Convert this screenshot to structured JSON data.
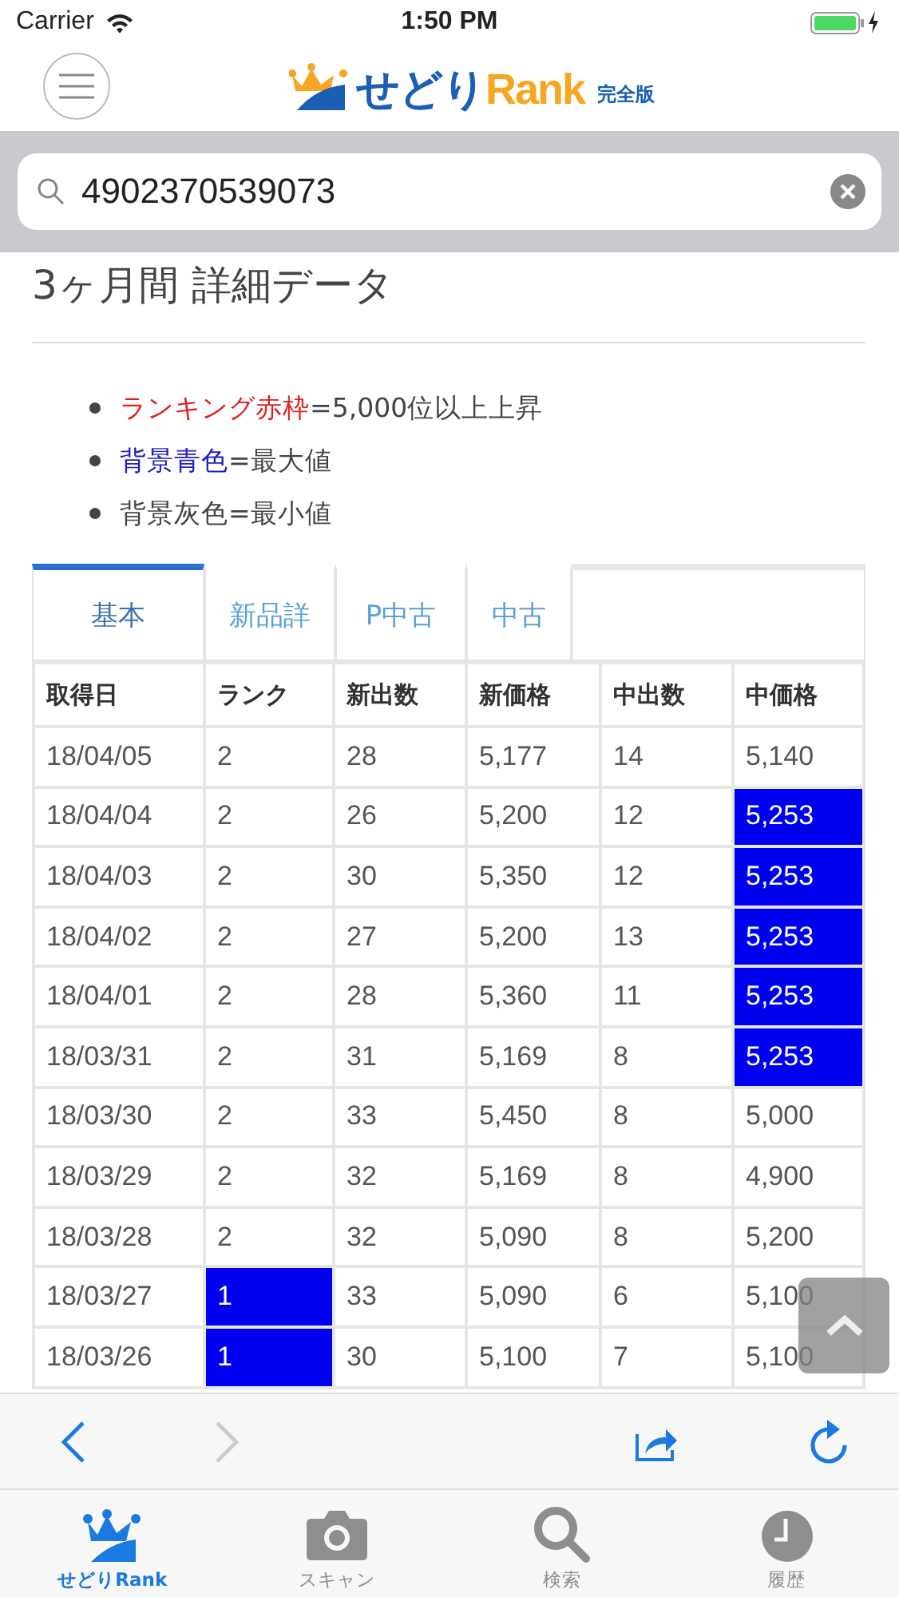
{
  "status_bar": {
    "carrier": "Carrier",
    "time": "1:50 PM"
  },
  "header": {
    "logo_main": "せどり",
    "logo_accent": "Rank",
    "edition": "完全版"
  },
  "search": {
    "value": "4902370539073"
  },
  "title": "3ヶ月間 詳細データ",
  "legend": [
    {
      "key": "ランキング赤枠",
      "rest": "=5,000位以上上昇",
      "color": "#e02020"
    },
    {
      "key": "背景青色",
      "rest": "=最大値",
      "color": "#2020c0"
    },
    {
      "key": "背景灰色",
      "rest": "=最小値",
      "color": "#444444"
    }
  ],
  "tabs": [
    {
      "label": "基本",
      "selected": true
    },
    {
      "label": "新品詳",
      "selected": false
    },
    {
      "label": "P中古",
      "selected": false
    },
    {
      "label": "中古",
      "selected": false
    }
  ],
  "table": {
    "columns": [
      "取得日",
      "ランク",
      "新出数",
      "新価格",
      "中出数",
      "中価格"
    ],
    "rows": [
      {
        "cells": [
          {
            "text": "18/04/05",
            "max": false
          },
          {
            "text": "2",
            "max": false
          },
          {
            "text": "28",
            "max": false
          },
          {
            "text": "5,177",
            "max": false
          },
          {
            "text": "14",
            "max": false
          },
          {
            "text": "5,140",
            "max": false
          }
        ]
      },
      {
        "cells": [
          {
            "text": "18/04/04",
            "max": false
          },
          {
            "text": "2",
            "max": false
          },
          {
            "text": "26",
            "max": false
          },
          {
            "text": "5,200",
            "max": false
          },
          {
            "text": "12",
            "max": false
          },
          {
            "text": "5,253",
            "max": true
          }
        ]
      },
      {
        "cells": [
          {
            "text": "18/04/03",
            "max": false
          },
          {
            "text": "2",
            "max": false
          },
          {
            "text": "30",
            "max": false
          },
          {
            "text": "5,350",
            "max": false
          },
          {
            "text": "12",
            "max": false
          },
          {
            "text": "5,253",
            "max": true
          }
        ]
      },
      {
        "cells": [
          {
            "text": "18/04/02",
            "max": false
          },
          {
            "text": "2",
            "max": false
          },
          {
            "text": "27",
            "max": false
          },
          {
            "text": "5,200",
            "max": false
          },
          {
            "text": "13",
            "max": false
          },
          {
            "text": "5,253",
            "max": true
          }
        ]
      },
      {
        "cells": [
          {
            "text": "18/04/01",
            "max": false
          },
          {
            "text": "2",
            "max": false
          },
          {
            "text": "28",
            "max": false
          },
          {
            "text": "5,360",
            "max": false
          },
          {
            "text": "11",
            "max": false
          },
          {
            "text": "5,253",
            "max": true
          }
        ]
      },
      {
        "cells": [
          {
            "text": "18/03/31",
            "max": false
          },
          {
            "text": "2",
            "max": false
          },
          {
            "text": "31",
            "max": false
          },
          {
            "text": "5,169",
            "max": false
          },
          {
            "text": "8",
            "max": false
          },
          {
            "text": "5,253",
            "max": true
          }
        ]
      },
      {
        "cells": [
          {
            "text": "18/03/30",
            "max": false
          },
          {
            "text": "2",
            "max": false
          },
          {
            "text": "33",
            "max": false
          },
          {
            "text": "5,450",
            "max": false
          },
          {
            "text": "8",
            "max": false
          },
          {
            "text": "5,000",
            "max": false
          }
        ]
      },
      {
        "cells": [
          {
            "text": "18/03/29",
            "max": false
          },
          {
            "text": "2",
            "max": false
          },
          {
            "text": "32",
            "max": false
          },
          {
            "text": "5,169",
            "max": false
          },
          {
            "text": "8",
            "max": false
          },
          {
            "text": "4,900",
            "max": false
          }
        ]
      },
      {
        "cells": [
          {
            "text": "18/03/28",
            "max": false
          },
          {
            "text": "2",
            "max": false
          },
          {
            "text": "32",
            "max": false
          },
          {
            "text": "5,090",
            "max": false
          },
          {
            "text": "8",
            "max": false
          },
          {
            "text": "5,200",
            "max": false
          }
        ]
      },
      {
        "cells": [
          {
            "text": "18/03/27",
            "max": false
          },
          {
            "text": "1",
            "max": true
          },
          {
            "text": "33",
            "max": false
          },
          {
            "text": "5,090",
            "max": false
          },
          {
            "text": "6",
            "max": false
          },
          {
            "text": "5,100",
            "max": false
          }
        ]
      },
      {
        "cells": [
          {
            "text": "18/03/26",
            "max": false
          },
          {
            "text": "1",
            "max": true
          },
          {
            "text": "30",
            "max": false
          },
          {
            "text": "5,100",
            "max": false
          },
          {
            "text": "7",
            "max": false
          },
          {
            "text": "5,100",
            "max": false
          }
        ]
      }
    ]
  },
  "toolbar": {
    "forward_disabled": true
  },
  "tab_bar": [
    {
      "label": "せどりRank",
      "kind": "crown",
      "selected": true
    },
    {
      "label": "スキャン",
      "kind": "camera",
      "selected": false
    },
    {
      "label": "検索",
      "kind": "search",
      "selected": false
    },
    {
      "label": "履歴",
      "kind": "clock",
      "selected": false
    }
  ]
}
